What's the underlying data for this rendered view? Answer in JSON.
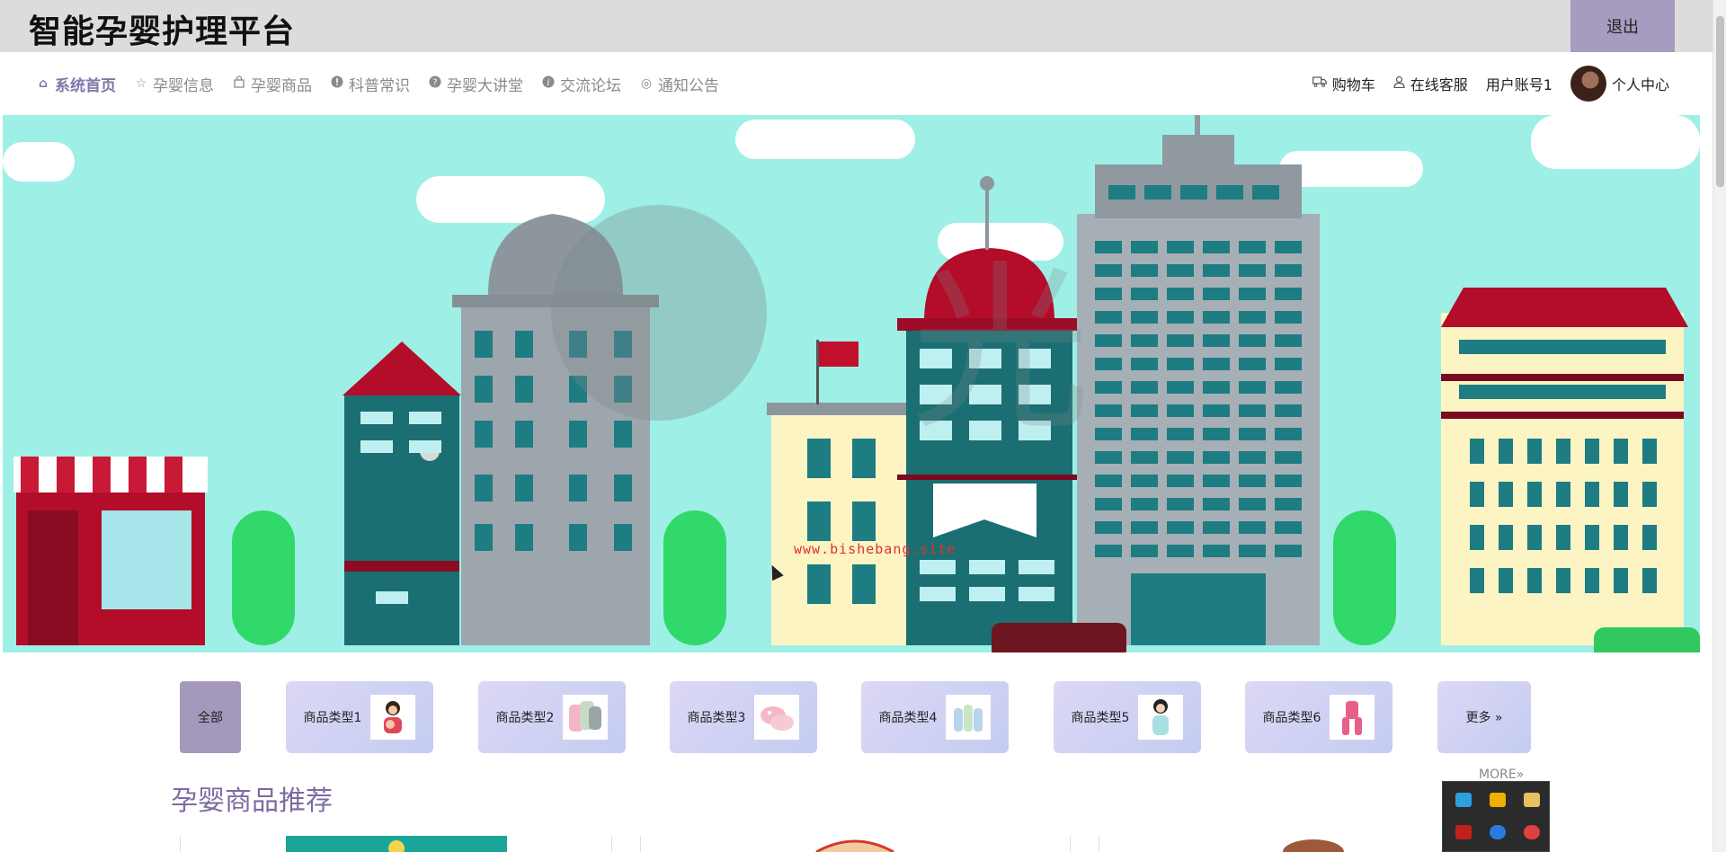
{
  "header": {
    "title": "智能孕婴护理平台",
    "logout_label": "退出"
  },
  "nav": {
    "items": [
      {
        "label": "系统首页",
        "icon": "home-icon",
        "glyph": "⌂",
        "active": true
      },
      {
        "label": "孕婴信息",
        "icon": "star-icon",
        "glyph": "☆"
      },
      {
        "label": "孕婴商品",
        "icon": "bag-icon",
        "glyph": "⌂"
      },
      {
        "label": "科普常识",
        "icon": "alert-icon",
        "glyph": "●"
      },
      {
        "label": "孕婴大讲堂",
        "icon": "question-icon",
        "glyph": "●"
      },
      {
        "label": "交流论坛",
        "icon": "info-icon",
        "glyph": "●"
      },
      {
        "label": "通知公告",
        "icon": "notice-icon",
        "glyph": "◎"
      }
    ],
    "right": {
      "cart_label": "购物车",
      "service_label": "在线客服",
      "account_label": "用户账号1",
      "center_label": "个人中心"
    }
  },
  "banner": {
    "watermark": "www.bishebang.site"
  },
  "categories": {
    "all_label": "全部",
    "items": [
      {
        "label": "商品类型1"
      },
      {
        "label": "商品类型2"
      },
      {
        "label": "商品类型3"
      },
      {
        "label": "商品类型4"
      },
      {
        "label": "商品类型5"
      },
      {
        "label": "商品类型6"
      }
    ],
    "more_label": "更多 »"
  },
  "section": {
    "title": "孕婴商品推荐",
    "more_label": "MORE»"
  },
  "colors": {
    "accent": "#7f78a8",
    "logout_bg": "#a79cc0",
    "banner_sky": "#9eefe6"
  }
}
